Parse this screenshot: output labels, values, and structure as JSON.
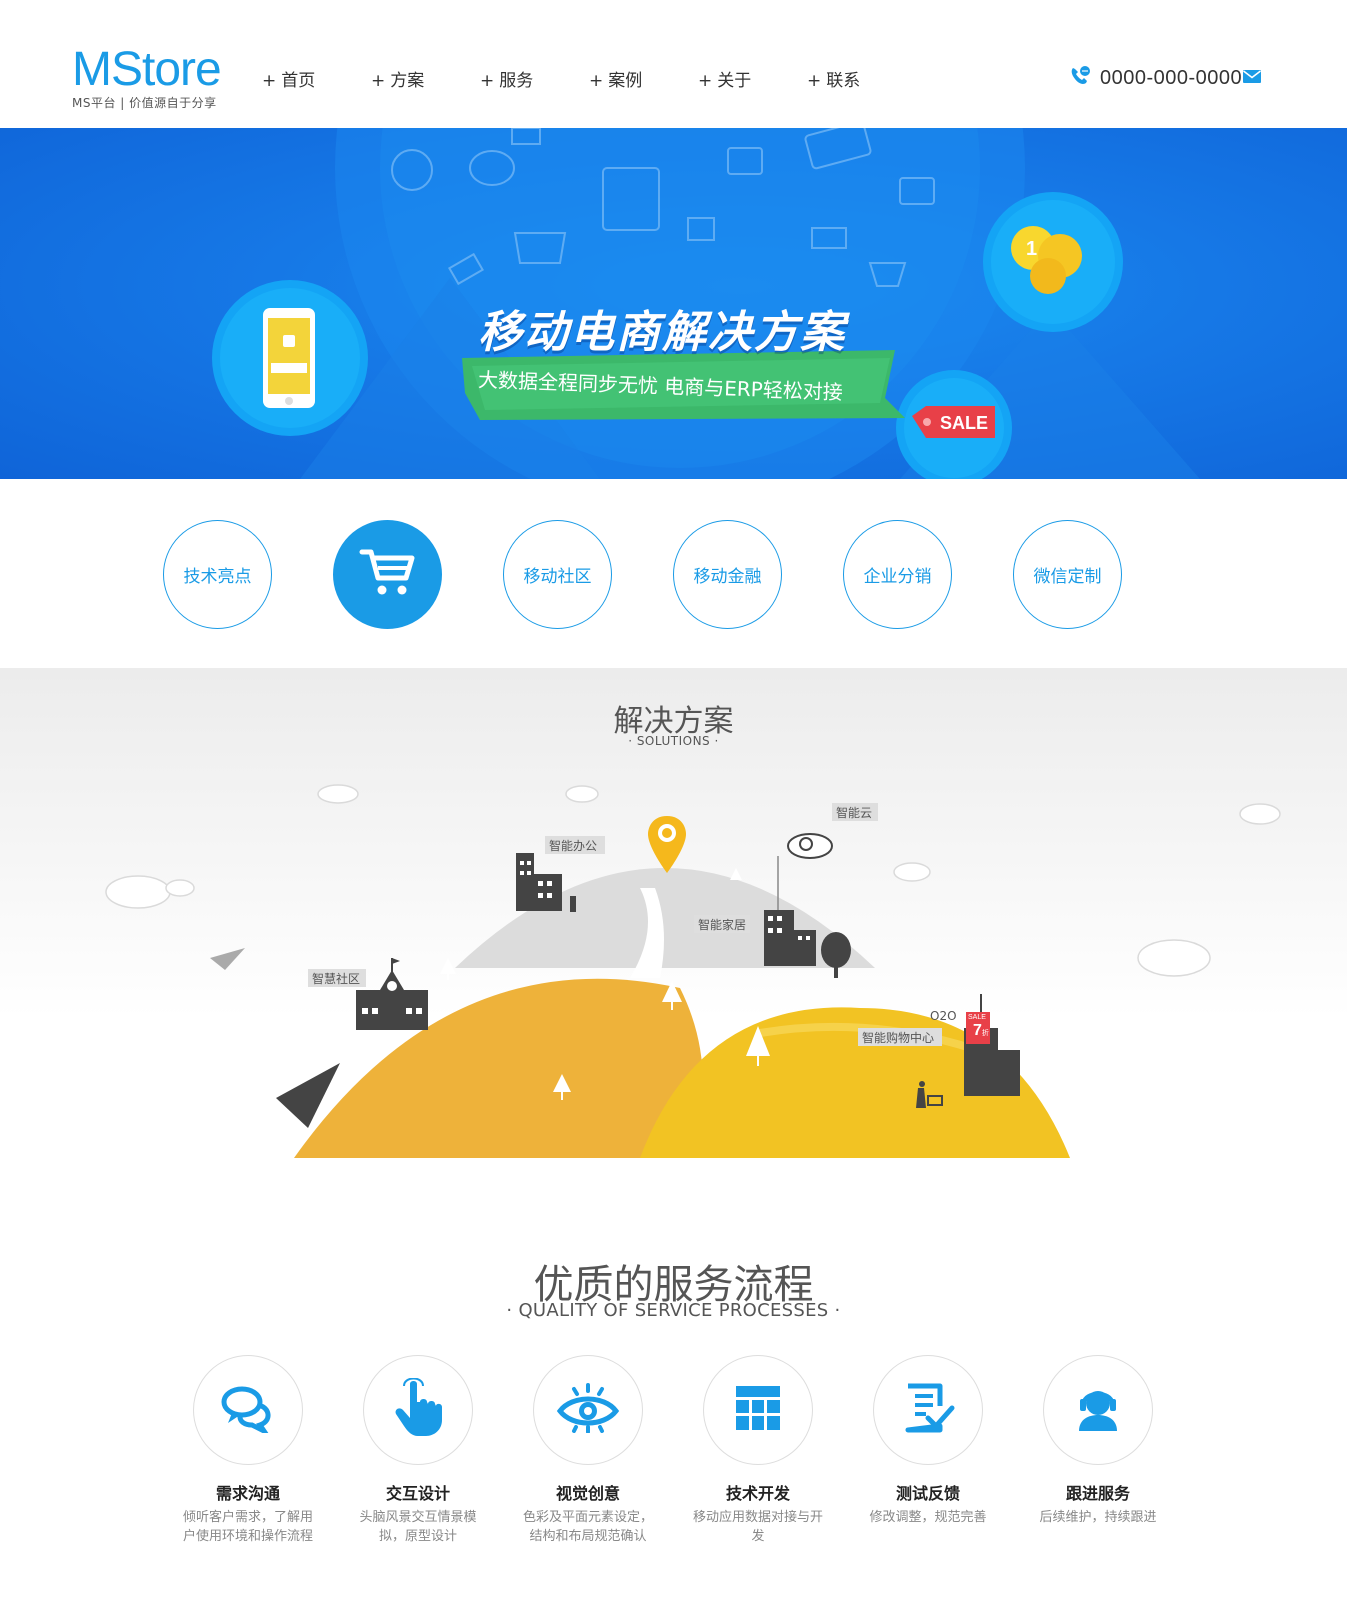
{
  "header": {
    "logo_name": "MStore",
    "logo_slogan": "MS平台 | 价值源自于分享",
    "nav": [
      {
        "plus": "+",
        "label": "首页"
      },
      {
        "plus": "+",
        "label": "方案"
      },
      {
        "plus": "+",
        "label": "服务"
      },
      {
        "plus": "+",
        "label": "案例"
      },
      {
        "plus": "+",
        "label": "关于"
      },
      {
        "plus": "+",
        "label": "联系"
      }
    ],
    "phone": "0000-000-0000"
  },
  "banner": {
    "title": "移动电商解决方案",
    "subtitle": "大数据全程同步无忧 电商与ERP轻松对接",
    "sale_tag": "SALE"
  },
  "categories": [
    {
      "label": "技术亮点",
      "active": false
    },
    {
      "label": "",
      "icon": "cart-icon",
      "active": true
    },
    {
      "label": "移动社区",
      "active": false
    },
    {
      "label": "移动金融",
      "active": false
    },
    {
      "label": "企业分销",
      "active": false
    },
    {
      "label": "微信定制",
      "active": false
    }
  ],
  "solutions": {
    "title": "解决方案",
    "subtitle": "· SOLUTIONS ·",
    "labels": {
      "office": "智能办公",
      "cloud": "智能云",
      "home": "智能家居",
      "community": "智慧社区",
      "o2o": "O2O",
      "mall": "智能购物中心",
      "sale_sign": "SALE",
      "discount": "7",
      "discount_unit": "折"
    }
  },
  "process": {
    "title": "优质的服务流程",
    "subtitle": "· QUALITY OF SERVICE PROCESSES ·",
    "steps": [
      {
        "title": "需求沟通",
        "desc": "倾听客户需求，了解用户使用环境和操作流程",
        "icon": "chat-bubbles-icon"
      },
      {
        "title": "交互设计",
        "desc": "头脑风景交互情景模拟，原型设计",
        "icon": "hand-touch-icon"
      },
      {
        "title": "视觉创意",
        "desc": "色彩及平面元素设定，结构和布局规范确认",
        "icon": "eye-icon"
      },
      {
        "title": "技术开发",
        "desc": "移动应用数据对接与开发",
        "icon": "grid-table-icon"
      },
      {
        "title": "测试反馈",
        "desc": "修改调整，规范完善",
        "icon": "checklist-icon"
      },
      {
        "title": "跟进服务",
        "desc": "后续维护，持续跟进",
        "icon": "support-agent-icon"
      }
    ]
  },
  "colors": {
    "accent": "#1a9be6",
    "banner_blue": "#1678e6",
    "hill_orange": "#eeb23a",
    "hill_yellow": "#f2c323",
    "ribbon_green": "#3cb86a",
    "sale_red": "#e84048"
  }
}
